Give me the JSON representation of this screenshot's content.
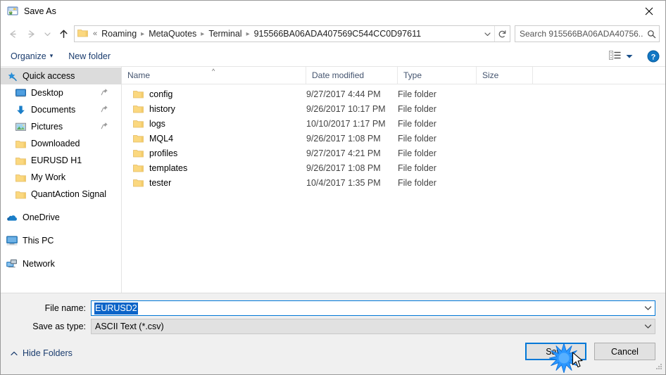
{
  "window": {
    "title": "Save As",
    "title_icon": "save-as-icon",
    "close_label": "✕"
  },
  "nav": {
    "back_icon": "arrow-left-icon",
    "forward_icon": "arrow-right-icon",
    "recent_icon": "chevron-down-icon",
    "up_icon": "arrow-up-icon",
    "folder_icon": "folder-icon",
    "breadcrumbs": [
      {
        "label": "«",
        "kind": "overflow"
      },
      {
        "label": "Roaming",
        "kind": "crumb"
      },
      {
        "label": "MetaQuotes",
        "kind": "crumb"
      },
      {
        "label": "Terminal",
        "kind": "crumb"
      },
      {
        "label": "915566BA06ADA407569C544CC0D97611",
        "kind": "crumb"
      }
    ],
    "dropdown_icon": "chevron-down-icon",
    "refresh_icon": "refresh-icon"
  },
  "search": {
    "placeholder": "Search 915566BA06ADA40756...",
    "value": "",
    "icon": "search-icon"
  },
  "toolbar": {
    "organize_label": "Organize",
    "organize_arrow": "▾",
    "new_folder_label": "New folder",
    "view_icon": "view-layout-icon",
    "view_arrow": "▾",
    "help_icon": "help-icon",
    "help_label": "?"
  },
  "sidebar": {
    "items": [
      {
        "label": "Quick access",
        "icon": "star-pin-icon",
        "selected": true,
        "pinned": false,
        "indent": "group",
        "gap_before": false
      },
      {
        "label": "Desktop",
        "icon": "desktop-icon",
        "selected": false,
        "pinned": true,
        "indent": "child",
        "gap_before": false
      },
      {
        "label": "Documents",
        "icon": "documents-download-icon",
        "selected": false,
        "pinned": true,
        "indent": "child",
        "gap_before": false
      },
      {
        "label": "Pictures",
        "icon": "pictures-icon",
        "selected": false,
        "pinned": true,
        "indent": "child",
        "gap_before": false
      },
      {
        "label": "Downloaded",
        "icon": "folder-icon",
        "selected": false,
        "pinned": false,
        "indent": "child",
        "gap_before": false
      },
      {
        "label": "EURUSD H1",
        "icon": "folder-icon",
        "selected": false,
        "pinned": false,
        "indent": "child",
        "gap_before": false
      },
      {
        "label": "My Work",
        "icon": "folder-icon",
        "selected": false,
        "pinned": false,
        "indent": "child",
        "gap_before": false
      },
      {
        "label": "QuantAction Signal",
        "icon": "folder-icon",
        "selected": false,
        "pinned": false,
        "indent": "child",
        "gap_before": false
      },
      {
        "label": "OneDrive",
        "icon": "onedrive-icon",
        "selected": false,
        "pinned": false,
        "indent": "group",
        "gap_before": true
      },
      {
        "label": "This PC",
        "icon": "this-pc-icon",
        "selected": false,
        "pinned": false,
        "indent": "group",
        "gap_before": true
      },
      {
        "label": "Network",
        "icon": "network-icon",
        "selected": false,
        "pinned": false,
        "indent": "group",
        "gap_before": true
      }
    ]
  },
  "filelist": {
    "columns": [
      {
        "key": "name",
        "label": "Name",
        "sorted": "ascending"
      },
      {
        "key": "date",
        "label": "Date modified",
        "sorted": ""
      },
      {
        "key": "type",
        "label": "Type",
        "sorted": ""
      },
      {
        "key": "size",
        "label": "Size",
        "sorted": ""
      }
    ],
    "sort_caret": "^",
    "rows": [
      {
        "name": "config",
        "date": "9/27/2017 4:44 PM",
        "type": "File folder",
        "size": "",
        "icon": "folder-icon"
      },
      {
        "name": "history",
        "date": "9/26/2017 10:17 PM",
        "type": "File folder",
        "size": "",
        "icon": "folder-icon"
      },
      {
        "name": "logs",
        "date": "10/10/2017 1:17 PM",
        "type": "File folder",
        "size": "",
        "icon": "folder-icon"
      },
      {
        "name": "MQL4",
        "date": "9/26/2017 1:08 PM",
        "type": "File folder",
        "size": "",
        "icon": "folder-icon"
      },
      {
        "name": "profiles",
        "date": "9/27/2017 4:21 PM",
        "type": "File folder",
        "size": "",
        "icon": "folder-icon"
      },
      {
        "name": "templates",
        "date": "9/26/2017 1:08 PM",
        "type": "File folder",
        "size": "",
        "icon": "folder-icon"
      },
      {
        "name": "tester",
        "date": "10/4/2017 1:35 PM",
        "type": "File folder",
        "size": "",
        "icon": "folder-icon"
      }
    ]
  },
  "footer": {
    "filename_label": "File name:",
    "filename_value": "EURUSD2",
    "filename_placeholder": "",
    "filename_selected": true,
    "filetype_label": "Save as type:",
    "filetype_value": "ASCII Text (*.csv)",
    "filetype_options": [
      "ASCII Text (*.csv)"
    ],
    "hide_folders_label": "Hide Folders",
    "hide_folders_arrow": "^",
    "save_label": "Save",
    "cancel_label": "Cancel",
    "focused_button": "Save",
    "resize_grip_icon": "resize-grip-icon"
  },
  "colors": {
    "accent": "#0078d7",
    "selection": "#0b64c8",
    "toolbar_link": "#1a3c6e",
    "column_header": "#44546f",
    "folder_yellow": "#fcd77f",
    "sidebar_selected": "#dcdcdc",
    "window_bg": "#ffffff",
    "footer_bg": "#f0f0f0",
    "click_burst": "#1e90ff"
  },
  "cursor": {
    "icon": "mouse-pointer-icon",
    "click_effect": "burst-icon"
  }
}
